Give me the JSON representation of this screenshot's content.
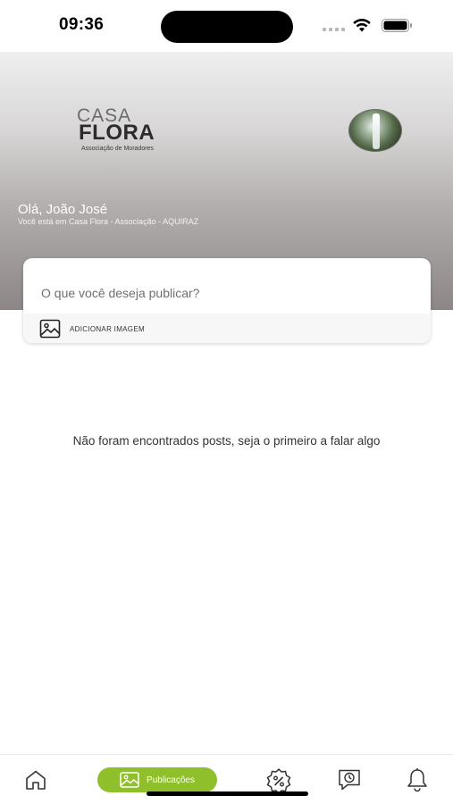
{
  "status_bar": {
    "time": "09:36"
  },
  "header": {
    "logo": {
      "line1": "CASA",
      "line2": "FLORA",
      "subtitle": "Associação de Moradores"
    },
    "greeting": "Olá, João José",
    "location": "Você está em Casa Flora - Associação - AQUIRAZ"
  },
  "composer": {
    "placeholder": "O que você deseja publicar?",
    "add_image_label": "ADICIONAR IMAGEM"
  },
  "feed": {
    "empty_message": "Não foram encontrados posts, seja o primeiro a falar algo"
  },
  "tab_bar": {
    "active_label": "Publicações",
    "accent_color": "#8fbf2b",
    "icons": [
      "home-icon",
      "image-icon",
      "discount-badge-icon",
      "chat-clock-icon",
      "bell-icon"
    ]
  }
}
